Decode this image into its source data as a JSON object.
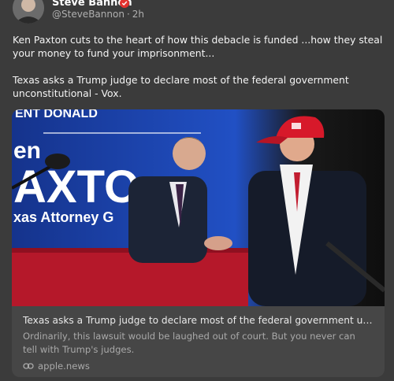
{
  "author": {
    "name": "Steve Bannon",
    "handle": "@SteveBannon",
    "time": "2h",
    "verified_color": "#e2332f"
  },
  "post": {
    "paragraph1": "Ken Paxton cuts to the heart of how this debacle is funded ...how they steal your money to fund your imprisonment...",
    "paragraph2": "Texas asks a Trump judge to declare most of the federal government unconstitutional - Vox."
  },
  "card": {
    "image_sign_line1": "ENT DONALD",
    "image_sign_line2": "en",
    "image_sign_line3": "AXTO",
    "image_sign_line4": "xas Attorney G",
    "title": "Texas asks a Trump judge to declare most of the federal government unconstitutional",
    "description": "Ordinarily, this lawsuit would be laughed out of court. But you never can tell with Trump's judges.",
    "source": "apple.news"
  },
  "colors": {
    "background": "#3b3b3b",
    "card": "#464646",
    "accent": "#e2332f",
    "sign_blue": "#1d3f9e"
  },
  "icons": {
    "verified": "verified-badge-icon",
    "link": "link-icon"
  }
}
